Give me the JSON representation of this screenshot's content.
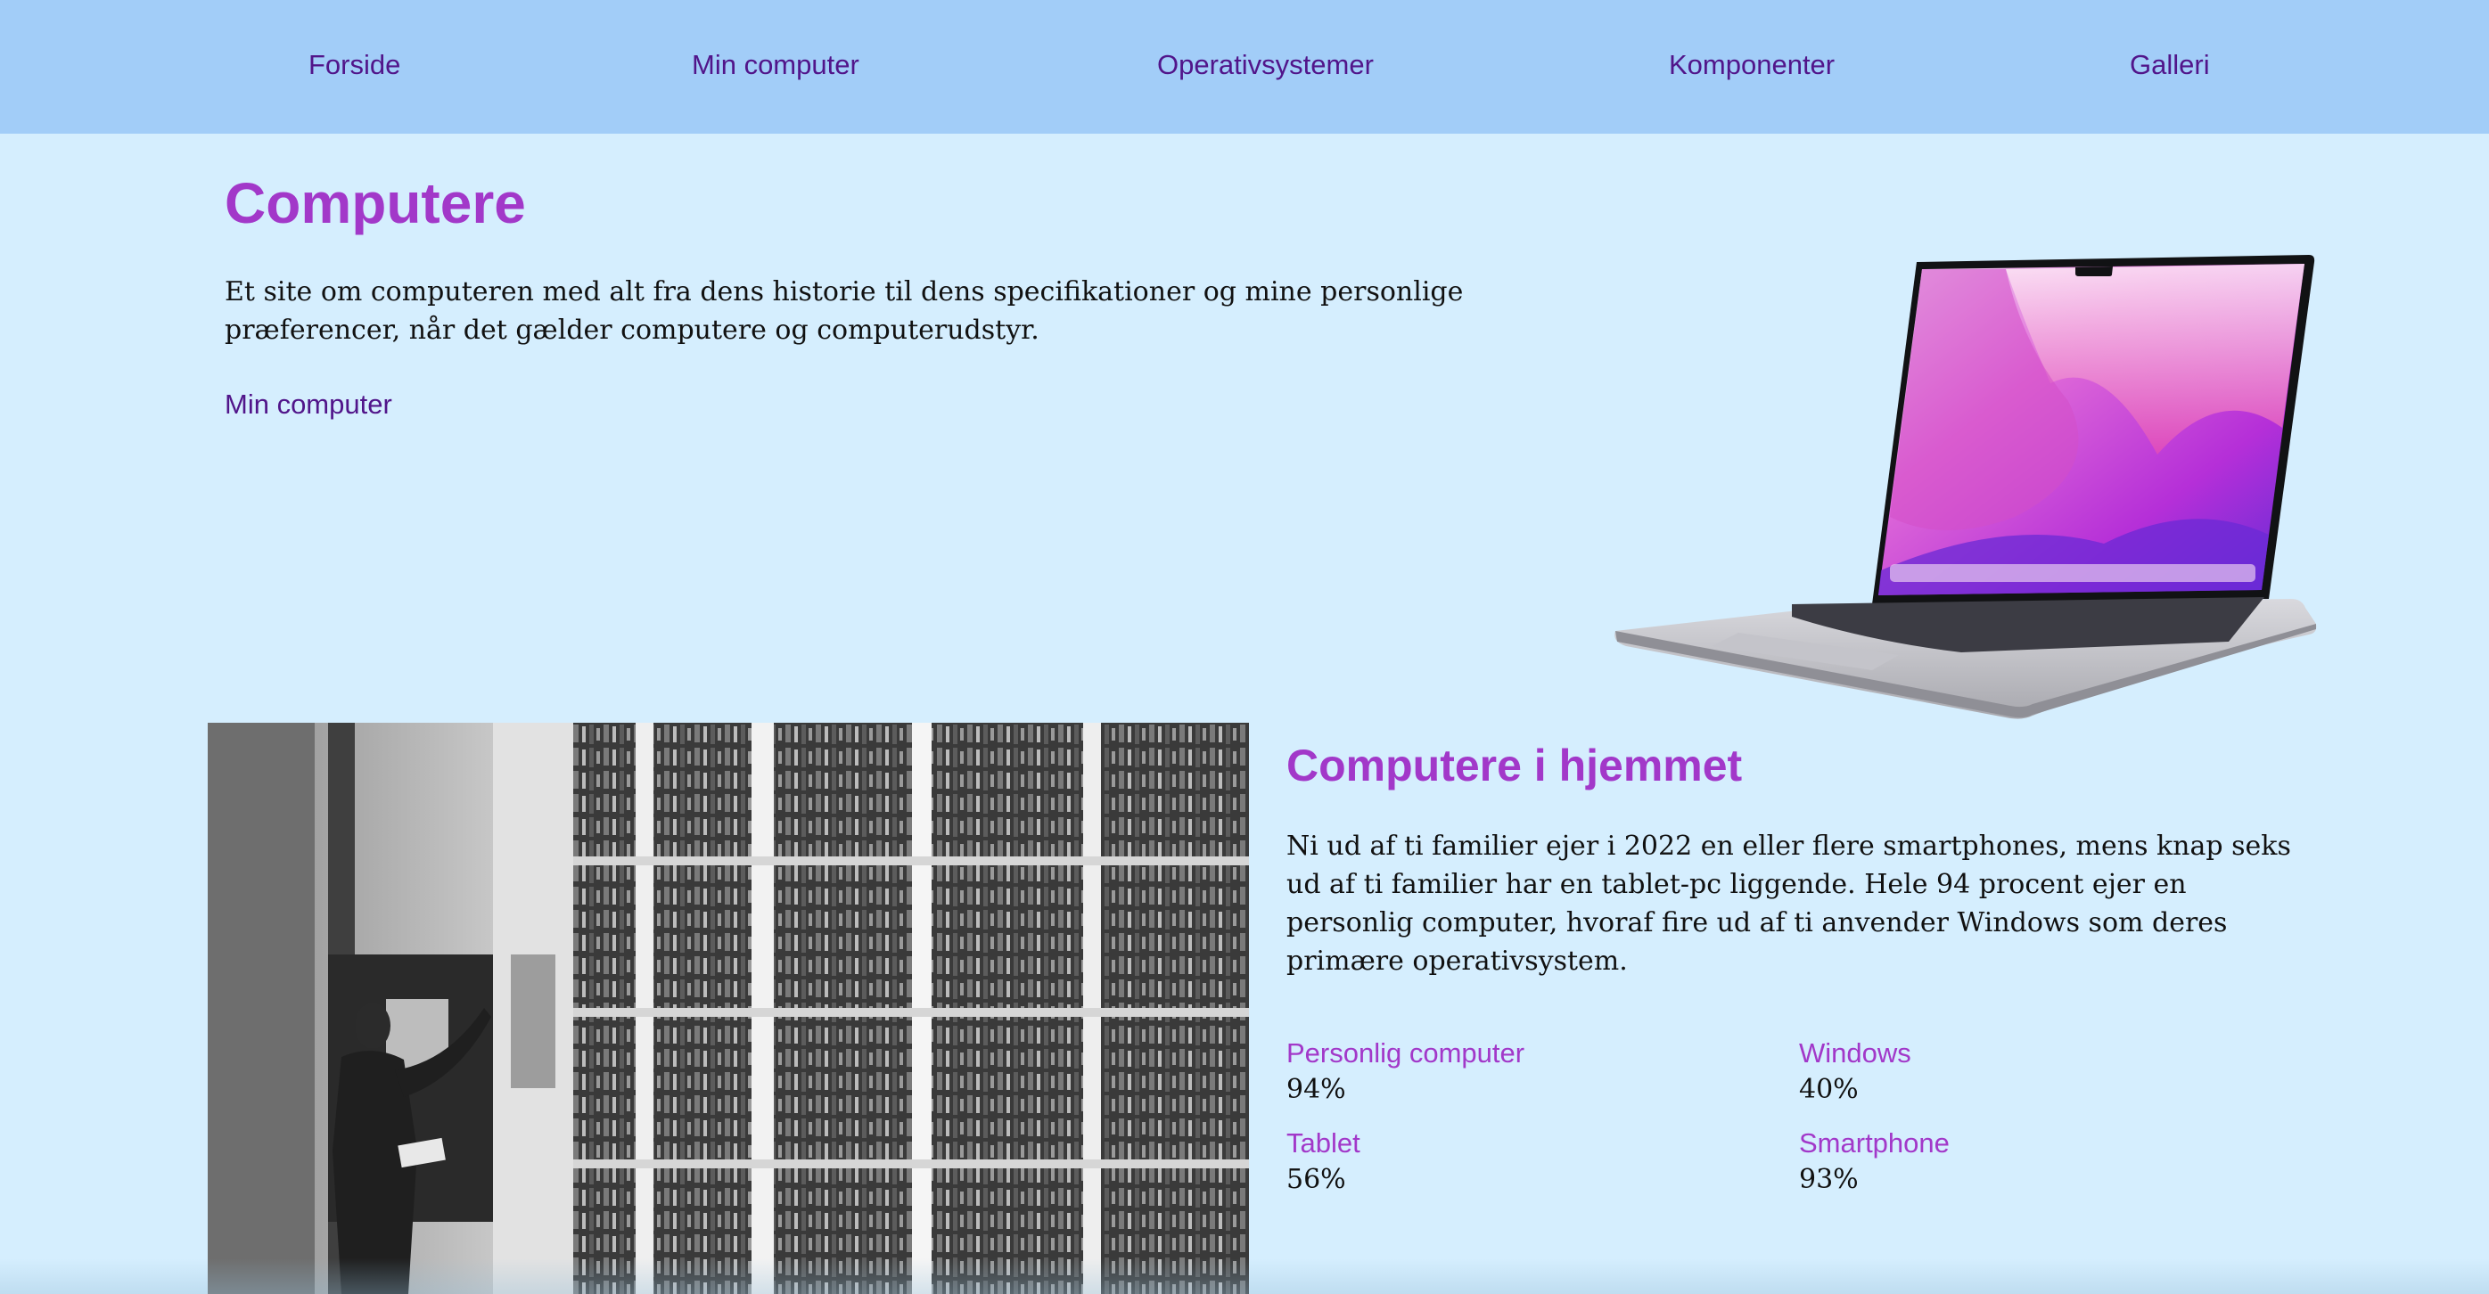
{
  "nav": {
    "items": [
      {
        "label": "Forside"
      },
      {
        "label": "Min computer"
      },
      {
        "label": "Operativsystemer"
      },
      {
        "label": "Komponenter"
      },
      {
        "label": "Galleri"
      }
    ]
  },
  "hero": {
    "title": "Computere",
    "text": "Et site om computeren med alt fra dens historie til dens specifikationer og mine personlige præferencer, når det gælder computere og computerudstyr.",
    "link_label": "Min computer"
  },
  "section": {
    "title": "Computere i hjemmet",
    "text": "Ni ud af ti familier ejer i 2022 en eller flere smartphones, mens knap seks ud af ti familier har en tablet-pc liggende. Hele 94 procent ejer en personlig computer, hvoraf fire ud af ti anvender Windows som deres primære operativsystem.",
    "stats": [
      {
        "label": "Personlig computer",
        "value": "94%"
      },
      {
        "label": "Windows",
        "value": "40%"
      },
      {
        "label": "Tablet",
        "value": "56%"
      },
      {
        "label": "Smartphone",
        "value": "93%"
      }
    ]
  },
  "colors": {
    "page_background": "#d5eefe",
    "nav_background": "#a2cdf8",
    "nav_link": "#51158a",
    "heading": "#a238c9",
    "body_text": "#111111"
  }
}
